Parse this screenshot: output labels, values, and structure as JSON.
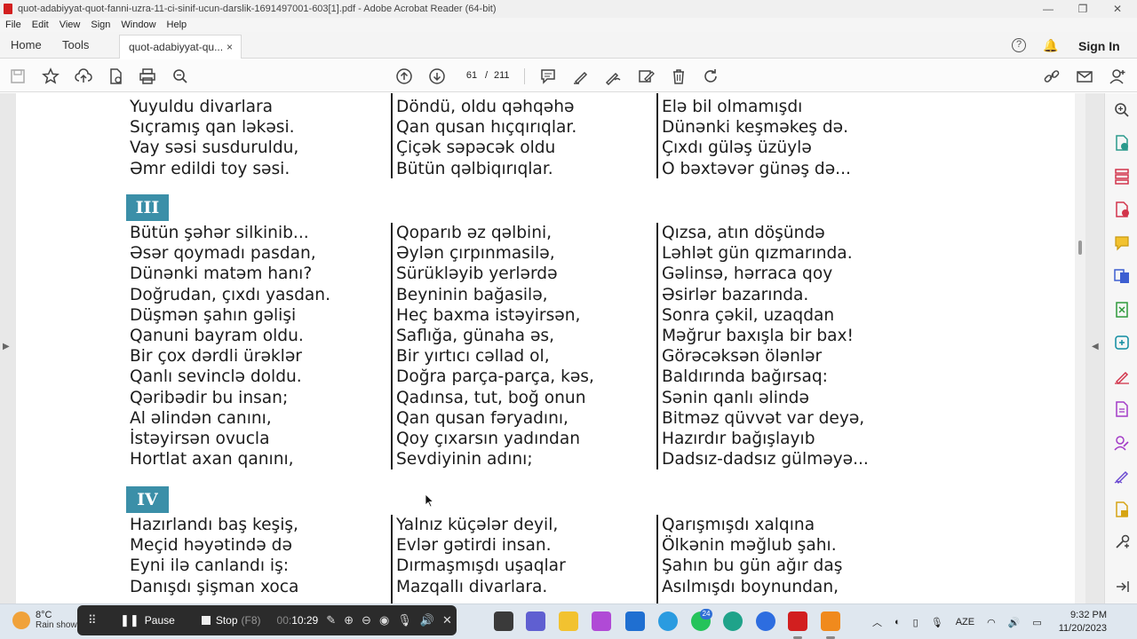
{
  "window": {
    "title": "quot-adabiyyat-quot-fanni-uzra-11-ci-sinif-ucun-darslik-1691497001-603[1].pdf - Adobe Acrobat Reader (64-bit)"
  },
  "menu": [
    "File",
    "Edit",
    "View",
    "Sign",
    "Window",
    "Help"
  ],
  "tabs": {
    "home": "Home",
    "tools": "Tools",
    "document_tab": "quot-adabiyyat-qu...",
    "close": "×",
    "sign_in": "Sign In",
    "help": "?"
  },
  "toolbar": {
    "page_current": "61",
    "page_sep": "/",
    "page_total": "211"
  },
  "document": {
    "section_top_columns": [
      [
        "Yuyuldu divarlara",
        "Sıçramış qan ləkəsi.",
        "Vay səsi susduruldu,",
        "Əmr edildi toy səsi."
      ],
      [
        "Döndü, oldu qəhqəhə",
        "Qan qusan hıçqırıqlar.",
        "Çiçək səpəcək oldu",
        "Bütün qəlbiqırıqlar."
      ],
      [
        "Elə bil olmamışdı",
        "Dünənki keşməkeş də.",
        "Çıxdı güləş üzüylə",
        "O bəxtəvər günəş də..."
      ]
    ],
    "sections": [
      {
        "numeral": "III",
        "columns": [
          [
            "Bütün şəhər silkinib...",
            "Əsər qoymadı pasdan,",
            "Dünənki matəm hanı?",
            "Doğrudan, çıxdı yasdan.",
            "Düşmən şahın gəlişi",
            "Qanuni bayram oldu.",
            "Bir çox dərdli ürəklər",
            "Qanlı sevinclə doldu.",
            "Qəribədir bu insan;",
            "Al əlindən canını,",
            "İstəyirsən ovucla",
            "Hortlat axan qanını,"
          ],
          [
            "Qoparıb əz qəlbini,",
            "Əylən çırpınmasilə,",
            "Sürükləyib yerlərdə",
            "Beyninin bağasilə,",
            "Heç baxma istəyirsən,",
            "Saflığa, günaha əs,",
            "Bir yırtıcı cəllad ol,",
            "Doğra parça-parça, kəs,",
            "Qadınsa, tut, boğ onun",
            "Qan qusan fəryadını,",
            "Qoy çıxarsın yadından",
            "Sevdiyinin adını;"
          ],
          [
            "Qızsa, atın döşündə",
            "Ləhlət gün qızmarında.",
            "Gəlinsə, hərraca qoy",
            "Əsirlər bazarında.",
            "Sonra çəkil, uzaqdan",
            "Məğrur baxışla bir bax!",
            "Görəcəksən ölənlər",
            "Baldırında bağırsaq:",
            "Sənin qanlı əlində",
            "Bitməz qüvvət var deyə,",
            "Hazırdır bağışlayıb",
            "Dadsız-dadsız gülməyə..."
          ]
        ]
      },
      {
        "numeral": "IV",
        "columns": [
          [
            "Hazırlandı baş keşiş,",
            "Meçid həyətində də",
            "Eyni ilə canlandı iş:",
            "Danışdı şişman xoca"
          ],
          [
            "Yalnız küçələr deyil,",
            "Evlər gətirdi insan.",
            "Dırmaşmışdı uşaqlar",
            "Mazqallı divarlara."
          ],
          [
            "Qarışmışdı xalqına",
            "Ölkənin məğlub şahı.",
            "Şahın bu gün ağır daş",
            "Asılmışdı boynundan,"
          ]
        ]
      }
    ]
  },
  "recorder": {
    "pause": "Pause",
    "stop": "Stop",
    "stop_hint": "(F8)",
    "time_dim": "00:",
    "time": "10:29"
  },
  "taskbar": {
    "temperature": "8°C",
    "weather": "Rain show",
    "notif_count": "24",
    "lang": "AZE",
    "time": "9:32 PM",
    "date": "11/20/2023"
  },
  "colors": {
    "section_badge": "#3b8fa8",
    "acrobat_red": "#d21f1f"
  }
}
